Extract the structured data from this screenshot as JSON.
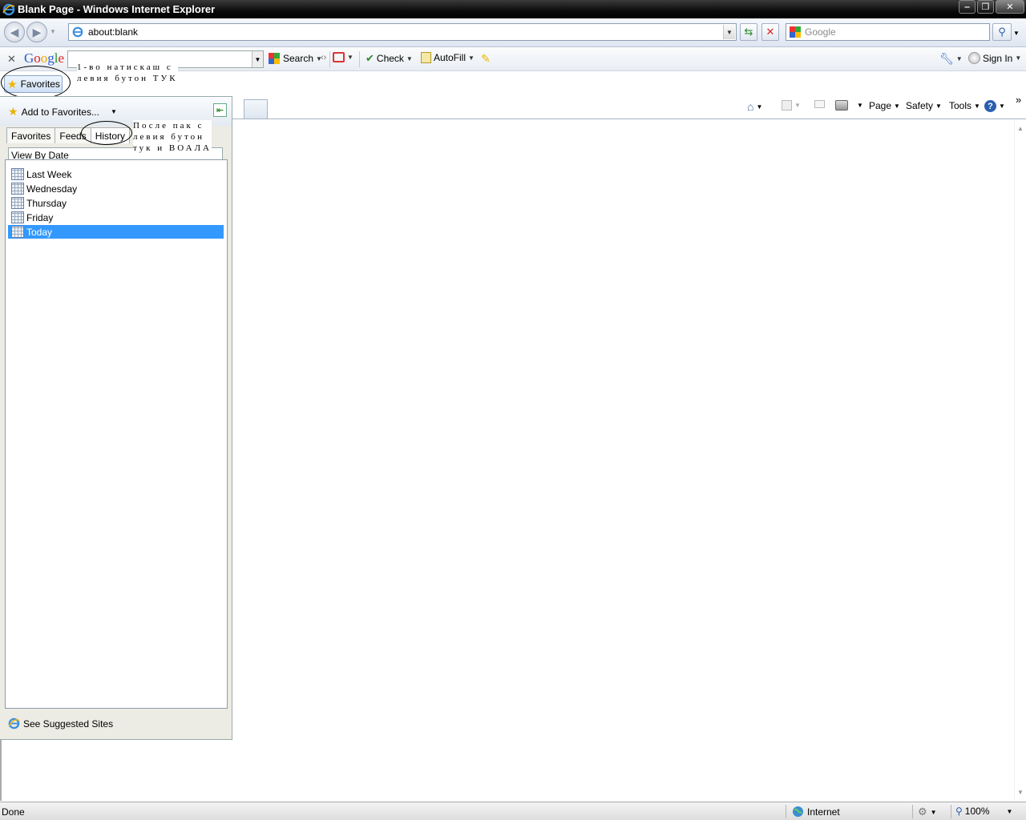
{
  "window": {
    "title": "Blank Page - Windows Internet Explorer",
    "minimize": "‒",
    "restore": "❐",
    "close": "✕"
  },
  "address_bar": {
    "url": "about:blank",
    "search_placeholder": "Google"
  },
  "google_toolbar": {
    "logo": "Google",
    "search_label": "Search",
    "check_label": "Check",
    "autofill_label": "AutoFill",
    "sign_in_label": "Sign In"
  },
  "favorites_bar": {
    "favorites_label": "Favorites"
  },
  "annotations": {
    "first_note": "1-во натискаш с\nлевия бутон ТУК",
    "second_note": "После пак с\nлевия бутон\nтук и ВОАЛА"
  },
  "command_bar": {
    "page_label": "Page",
    "safety_label": "Safety",
    "tools_label": "Tools",
    "help_label": "?",
    "more": "»"
  },
  "favorites_panel": {
    "add_to_favorites": "Add to Favorites...",
    "tabs": [
      "Favorites",
      "Feeds",
      "History"
    ],
    "active_tab": "History",
    "view_by": "View By Date",
    "items": [
      "Last Week",
      "Wednesday",
      "Thursday",
      "Friday",
      "Today"
    ],
    "selected_item": "Today",
    "suggested_sites": "See Suggested Sites"
  },
  "status_bar": {
    "status": "Done",
    "zone": "Internet",
    "zoom": "100%"
  },
  "colors": {
    "selection": "#3399ff",
    "title_bar": "#000000"
  }
}
